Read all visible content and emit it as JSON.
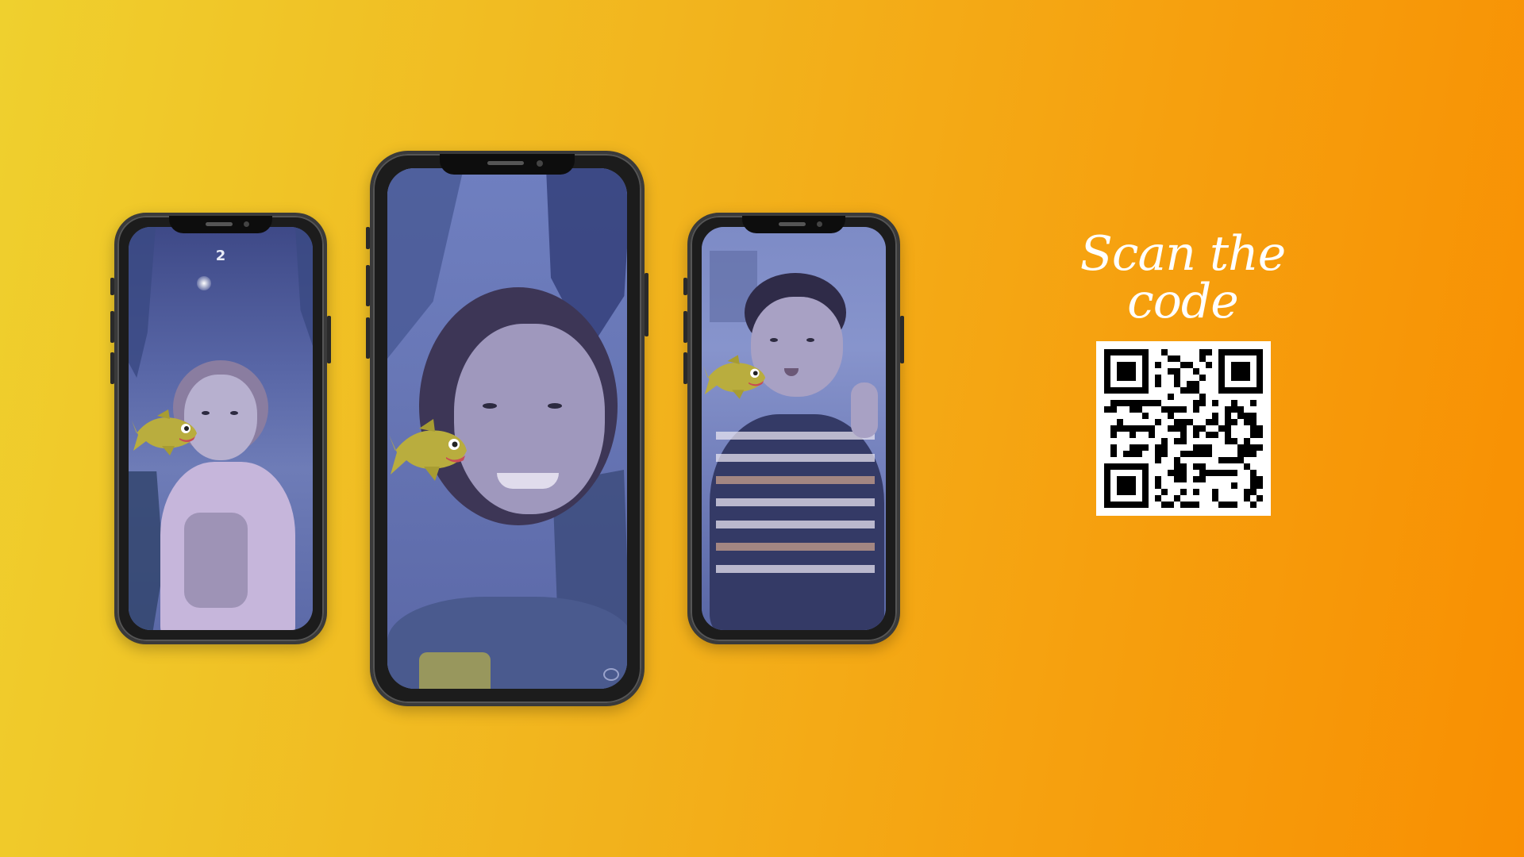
{
  "headline": "Scan the code",
  "phones": {
    "left": {
      "score": "2"
    }
  },
  "colors": {
    "bg_start": "#efd02e",
    "bg_end": "#f88f02",
    "screen_tint": "#5968a8",
    "text": "#ffffff"
  },
  "icons": {
    "shark": "shark-icon",
    "qr": "qr-code-icon"
  }
}
